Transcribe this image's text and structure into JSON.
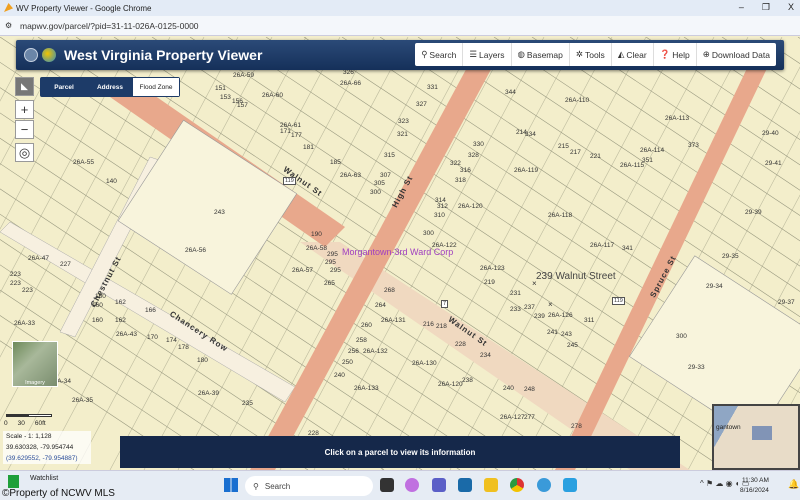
{
  "window": {
    "title": "WV Property Viewer - Google Chrome",
    "minimize": "–",
    "restore": "❐",
    "close": "X",
    "url": "mapwv.gov/parcel/?pid=31-11-026A-0125-0000"
  },
  "header": {
    "title": "West Virginia Property Viewer",
    "tools": [
      {
        "icon": "search-icon",
        "glyph": "⚲",
        "label": "Search"
      },
      {
        "icon": "layers-icon",
        "glyph": "☰",
        "label": "Layers"
      },
      {
        "icon": "globe-icon",
        "glyph": "◍",
        "label": "Basemap"
      },
      {
        "icon": "gear-icon",
        "glyph": "✲",
        "label": "Tools"
      },
      {
        "icon": "eraser-icon",
        "glyph": "◭",
        "label": "Clear"
      },
      {
        "icon": "help-icon",
        "glyph": "❓",
        "label": "Help"
      },
      {
        "icon": "download-icon",
        "glyph": "⊕",
        "label": "Download Data"
      }
    ]
  },
  "search_tabs": [
    {
      "label": "Parcel",
      "active": false
    },
    {
      "label": "Address",
      "active": false
    },
    {
      "label": "Flood Zone",
      "active": true
    }
  ],
  "map_controls": {
    "zoom_in": "+",
    "zoom_out": "−",
    "locate": "◎",
    "imagery": "Imagery"
  },
  "map": {
    "streets": [
      "Walnut St",
      "High St",
      "Walnut St",
      "Spruce St",
      "Chancery Row",
      "Chestnut St"
    ],
    "route_shields": [
      "119",
      "119",
      "7"
    ],
    "district": "Morgantown-3rd Ward Corp",
    "address": "239 Walnut Street",
    "parcels": [
      "26A-59",
      "326",
      "26A-66",
      "331",
      "151",
      "153",
      "156",
      "26A-60",
      "157",
      "26A-61",
      "171",
      "177",
      "181",
      "185",
      "26A-63",
      "327",
      "323",
      "321",
      "315",
      "307",
      "305",
      "300",
      "26A-55",
      "140",
      "243",
      "190",
      "26A-58",
      "295",
      "295",
      "295",
      "26A-57",
      "265",
      "26A-56",
      "26A-47",
      "227",
      "223",
      "223",
      "223",
      "26A-33",
      "160",
      "160",
      "160",
      "162",
      "162",
      "166",
      "26A-43",
      "170",
      "174",
      "178",
      "180",
      "26A-34",
      "26A-35",
      "26A-39",
      "235",
      "268",
      "264",
      "26A-131",
      "260",
      "258",
      "256",
      "250",
      "240",
      "26A-132",
      "26A-130",
      "216",
      "218",
      "228",
      "234",
      "26A-133",
      "26A-120",
      "238",
      "240",
      "248",
      "26A-127",
      "277",
      "278",
      "228",
      "344",
      "26A-110",
      "334",
      "214",
      "330",
      "328",
      "322",
      "316",
      "318",
      "314",
      "312",
      "310",
      "26A-120",
      "26A-119",
      "300",
      "26A-122",
      "26A-123",
      "219",
      "231",
      "233",
      "237",
      "239",
      "26A-126",
      "241",
      "243",
      "245",
      "311",
      "26A-118",
      "26A-117",
      "341",
      "26A-113",
      "373",
      "26A-114",
      "26A-115",
      "351",
      "215",
      "217",
      "221",
      "29-40",
      "29-41",
      "29-39",
      "29-35",
      "29-34",
      "29-37",
      "300",
      "29-33"
    ]
  },
  "scale": {
    "ticks": [
      "0",
      "30",
      "60ft"
    ],
    "ratio": "Scale - 1: 1,128",
    "coords": "39.630328, -79.954744",
    "coords_alt": "(39.629552, -79.954887)"
  },
  "message": "Click on a parcel to view its information",
  "overview": {
    "label": "gantown"
  },
  "taskbar": {
    "watchlist": "Watchlist",
    "watermark": "©Property of NCWV MLS",
    "search": "Search",
    "time": "11:30 AM",
    "date": "8/16/2024"
  },
  "colors": {
    "header": "#1d3b68",
    "road": "#e8a88c",
    "parcel": "#f3eecb",
    "message_bar": "#15284a"
  }
}
